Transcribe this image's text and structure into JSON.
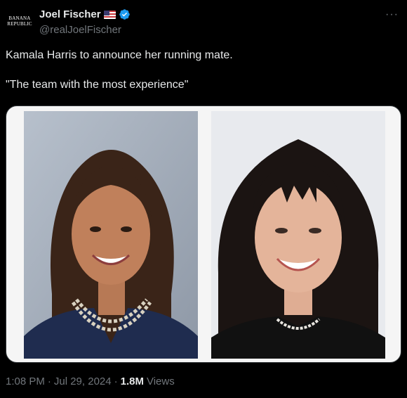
{
  "author": {
    "avatar_text_line1": "BANANA",
    "avatar_text_line2": "REPUBLIC",
    "display_name": "Joel Fischer",
    "handle": "@realJoelFischer",
    "flag_icon": "us-flag-icon",
    "verified_icon": "verified-badge-icon",
    "verified_color": "#1d9bf0"
  },
  "menu": {
    "more_icon": "more-horizontal-icon"
  },
  "tweet": {
    "line1": "Kamala Harris to announce her running mate.",
    "line2": "\"The team with the most experience\""
  },
  "media": {
    "photos": [
      {
        "icon": "portrait-photo"
      },
      {
        "icon": "portrait-photo"
      }
    ]
  },
  "meta": {
    "time": "1:08 PM",
    "sep1": "·",
    "date": "Jul 29, 2024",
    "sep2": "·",
    "views_count": "1.8M",
    "views_label": "Views"
  },
  "colors": {
    "background": "#000000",
    "text_primary": "#e7e9ea",
    "text_secondary": "#71767b"
  }
}
